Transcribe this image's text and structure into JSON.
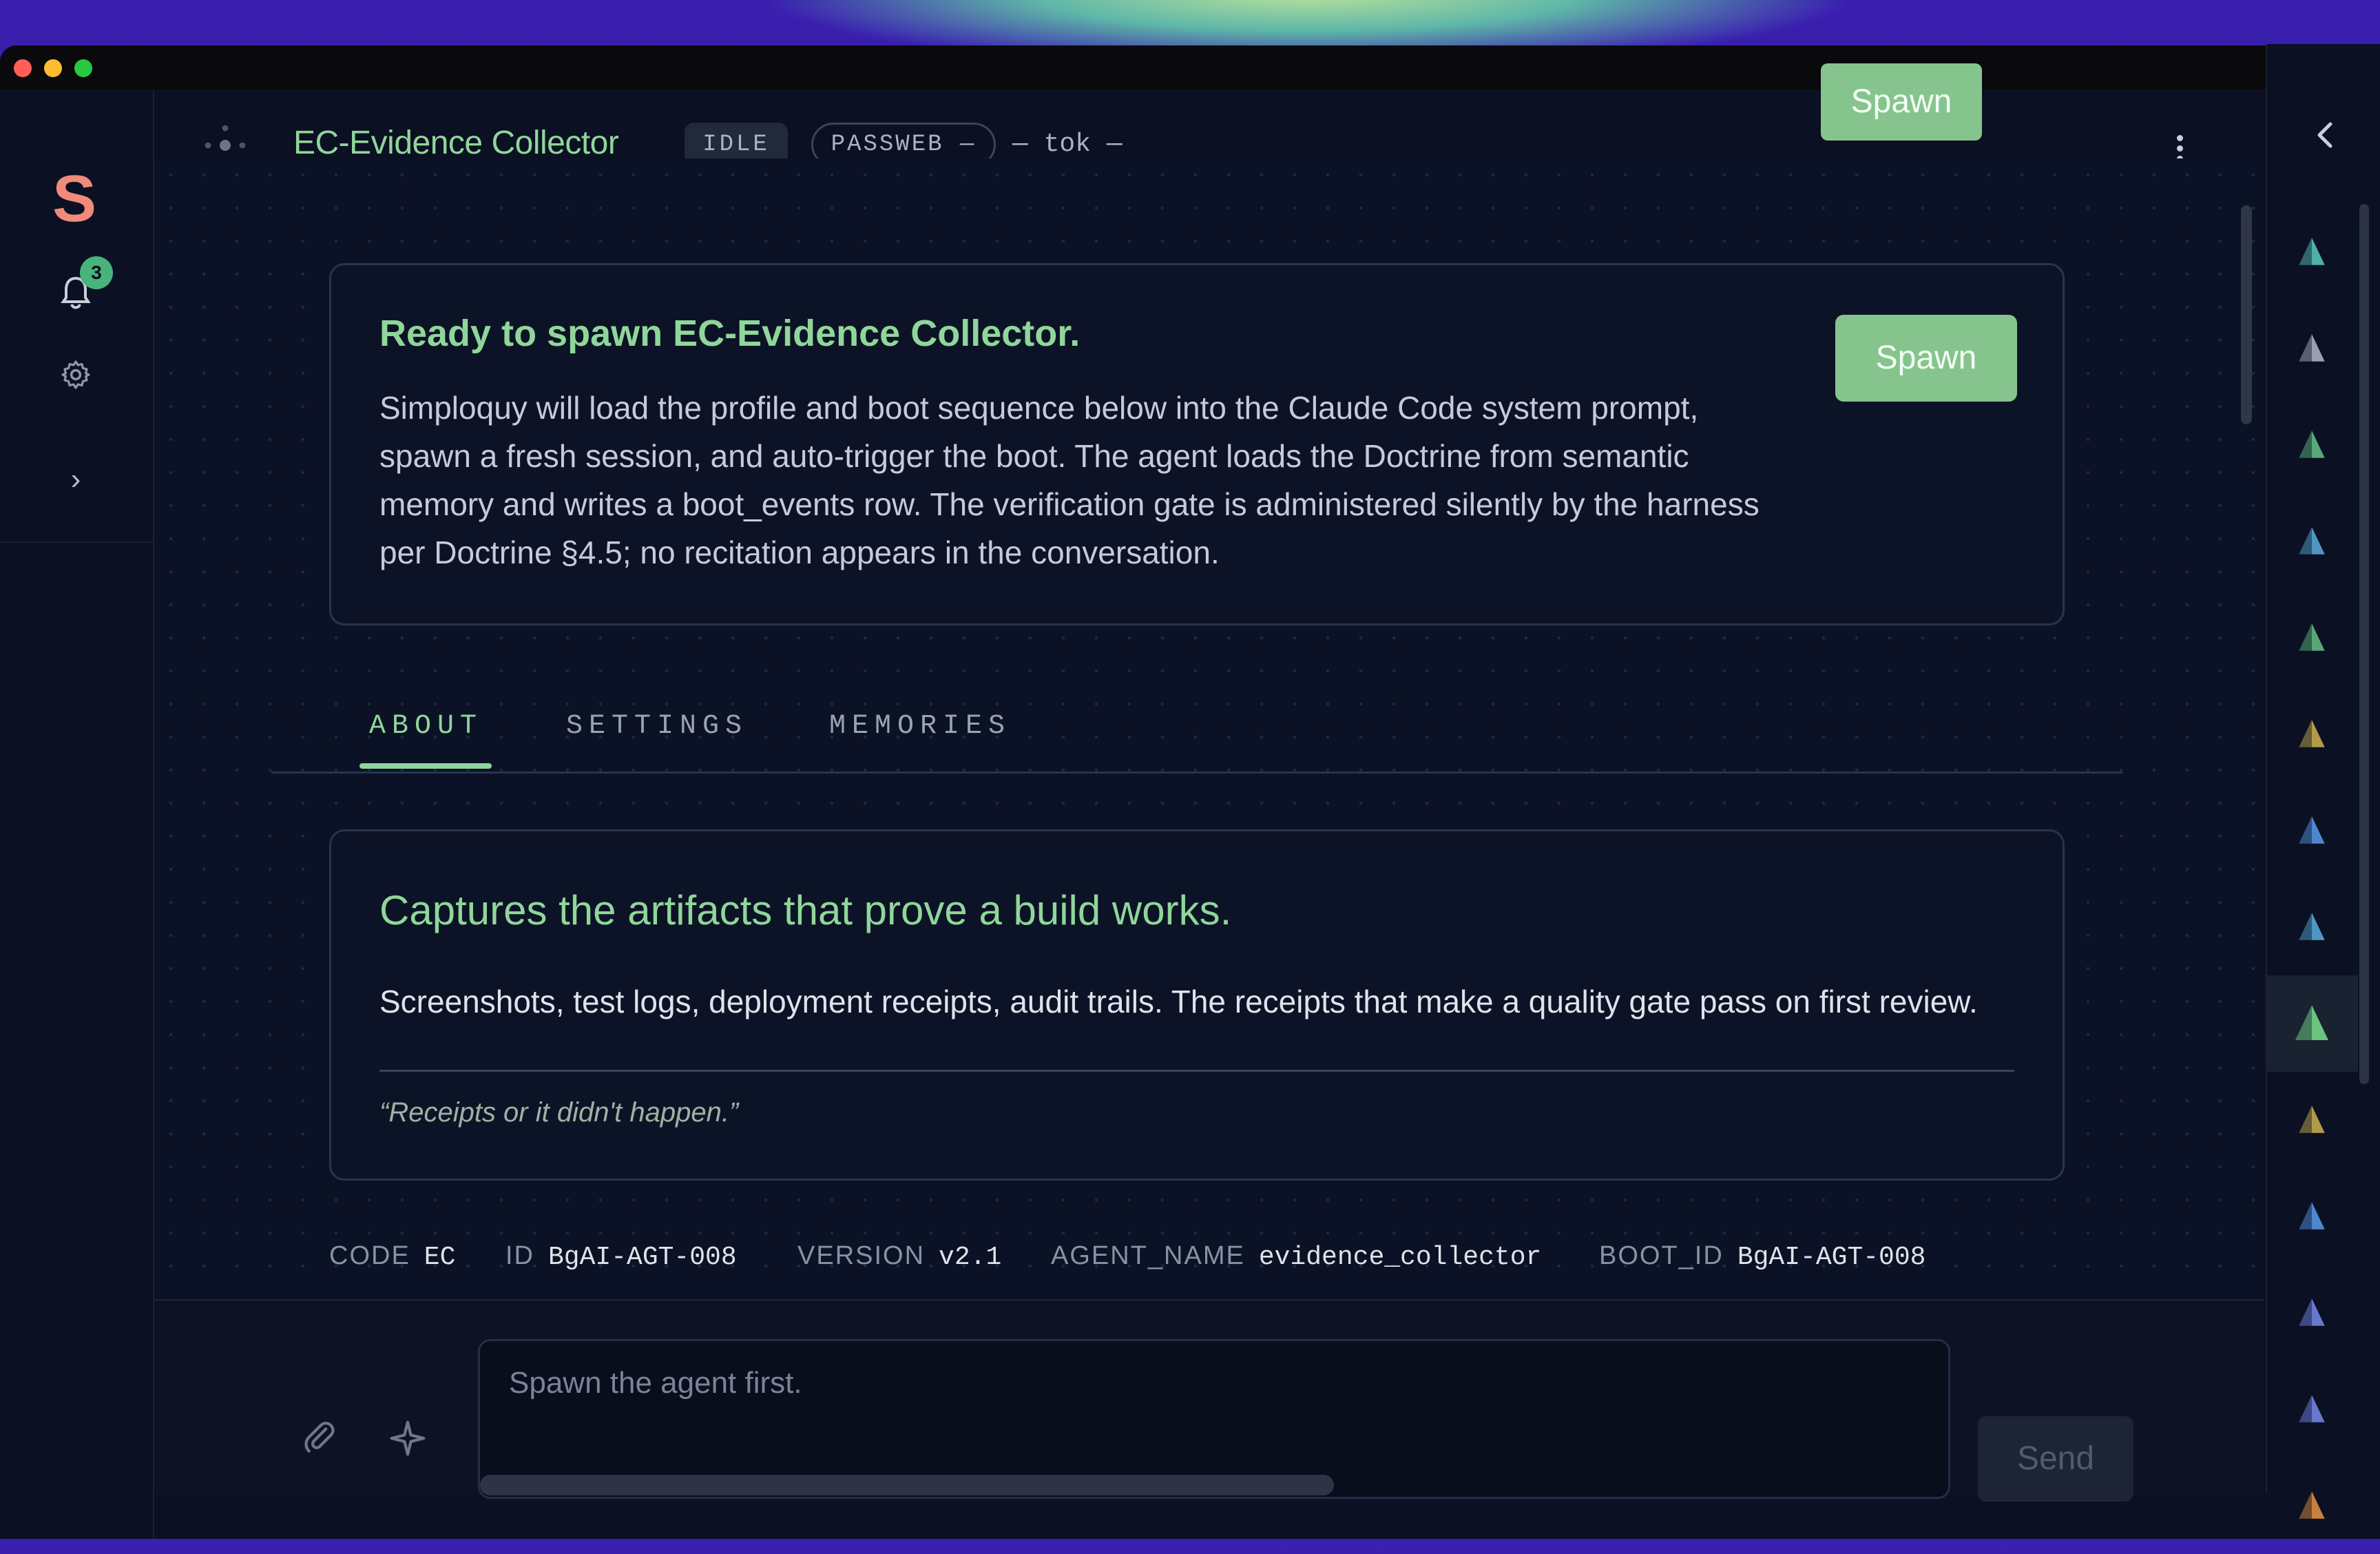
{
  "app": {
    "logo_letter": "S",
    "notifications_count": "3"
  },
  "header": {
    "title": "EC-Evidence Collector",
    "status": "IDLE",
    "tag": "PASSWEB —",
    "tokens": "— tok —",
    "spawn_label": "Spawn"
  },
  "ready_card": {
    "title": "Ready to spawn EC-Evidence Collector.",
    "body": "Simploquy will load the profile and boot sequence below into the Claude Code system prompt, spawn a fresh session, and auto-trigger the boot. The agent loads the Doctrine from semantic memory and writes a boot_events row. The verification gate is administered silently by the harness per Doctrine §4.5; no recitation appears in the conversation.",
    "spawn_label": "Spawn"
  },
  "tabs": [
    {
      "label": "ABOUT",
      "active": true
    },
    {
      "label": "SETTINGS",
      "active": false
    },
    {
      "label": "MEMORIES",
      "active": false
    }
  ],
  "about": {
    "headline": "Captures the artifacts that prove a build works.",
    "description": "Screenshots, test logs, deployment receipts, audit trails. The receipts that make a quality gate pass on first review.",
    "quote": "“Receipts or it didn't happen.”"
  },
  "meta": [
    {
      "key": "CODE",
      "value": "EC"
    },
    {
      "key": "ID",
      "value": "BgAI-AGT-008"
    },
    {
      "key": "VERSION",
      "value": "v2.1"
    },
    {
      "key": "AGENT_NAME",
      "value": "evidence_collector"
    },
    {
      "key": "BOOT_ID",
      "value": "BgAI-AGT-008"
    }
  ],
  "composer": {
    "placeholder": "Spawn the agent first.",
    "send_label": "Send"
  },
  "agent_rail": [
    {
      "color": "#4fb0a8",
      "active": false
    },
    {
      "color": "#9aa0ad",
      "active": false
    },
    {
      "color": "#56a879",
      "active": false
    },
    {
      "color": "#4f97c2",
      "active": false
    },
    {
      "color": "#56a879",
      "active": false
    },
    {
      "color": "#b39a4a",
      "active": false
    },
    {
      "color": "#4f86d0",
      "active": false
    },
    {
      "color": "#4f97c2",
      "active": false
    },
    {
      "color": "#6bc47f",
      "active": true
    },
    {
      "color": "#b39a4a",
      "active": false
    },
    {
      "color": "#4f86d0",
      "active": false
    },
    {
      "color": "#6878d0",
      "active": false
    },
    {
      "color": "#6878d0",
      "active": false
    },
    {
      "color": "#c8803f",
      "active": false
    }
  ],
  "colors": {
    "accent_green": "#8fd69a",
    "button_green": "#86c48e",
    "background": "#0b1022",
    "badge_green": "#48b37a",
    "logo_coral": "#f08a7a"
  },
  "icons": {
    "agent": "network-node-icon",
    "bell": "bell-icon",
    "gear": "gear-icon",
    "expand": "chevron-right-icon",
    "collapse": "chevron-left-icon",
    "more": "vertical-ellipsis-icon",
    "attach": "paperclip-icon",
    "sparkle": "sparkle-icon",
    "rail_item": "pyramid-icon"
  }
}
